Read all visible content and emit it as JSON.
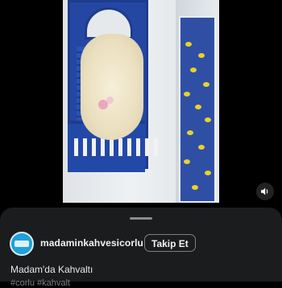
{
  "video": {
    "mute_icon": "speaker-icon"
  },
  "post": {
    "username": "madaminkahvesicorlu",
    "follow_label": "Takip Et",
    "caption": "Madam'da Kahvaltı",
    "hashtags": "#corlu #kahvalt"
  },
  "colors": {
    "sheet_bg": "#1a1c1e",
    "avatar_bg": "#1fa0d8"
  }
}
